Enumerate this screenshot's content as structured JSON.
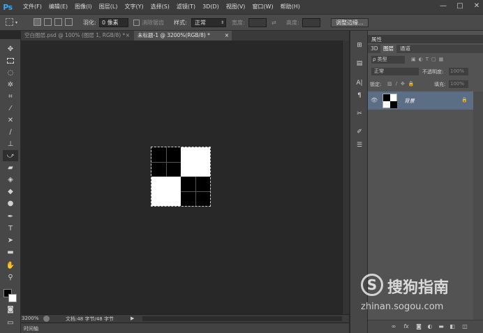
{
  "app": {
    "logo_text": "Ps"
  },
  "menu": [
    "文件(F)",
    "编辑(E)",
    "图像(I)",
    "图层(L)",
    "文字(Y)",
    "选择(S)",
    "滤镜(T)",
    "3D(D)",
    "视图(V)",
    "窗口(W)",
    "帮助(H)"
  ],
  "window_controls": [
    "—",
    "□",
    "✕"
  ],
  "options": {
    "feather_label": "羽化:",
    "feather_value": "0 像素",
    "antialias_label": "消除锯齿",
    "style_label": "样式:",
    "style_value": "正常",
    "width_label": "宽度:",
    "height_label": "高度:",
    "refine_button": "调整边缘..."
  },
  "tabs": [
    {
      "label": "空白图层.psd @ 100% (图层 1, RGB/8) *",
      "active": false,
      "close": "×"
    },
    {
      "label": "未标题-1 @ 3200%(RGB/8) *",
      "active": true,
      "close": "×"
    }
  ],
  "status": {
    "zoom": "3200%",
    "doc": "文档:48 字节/48 字节",
    "arrow": "▶"
  },
  "timeline_label": "时间轴",
  "panel": {
    "header_title": "属性",
    "tabs": [
      "3D",
      "图层",
      "通道"
    ],
    "filter_label": "ρ 类型",
    "blend_mode": "正常",
    "opacity_label": "不透明度:",
    "opacity_value": "100%",
    "lock_label": "锁定:",
    "fill_label": "填充:",
    "fill_value": "100%",
    "layer": {
      "name": "背景",
      "lock_icon": "🔒"
    }
  },
  "canvas_image": {
    "grid": [
      [
        "black",
        "white"
      ],
      [
        "white",
        "black"
      ]
    ]
  },
  "watermark": {
    "brand": "搜狗指南",
    "url": "zhinan.sogou.com",
    "logo_letter": "S"
  },
  "colors": {
    "menubar": "#3c3c3c",
    "optbar": "#4a4a4a",
    "canvas": "#282828",
    "panel": "#535353",
    "layer_selected": "#5c6e86",
    "accent": "#3da7f0"
  }
}
